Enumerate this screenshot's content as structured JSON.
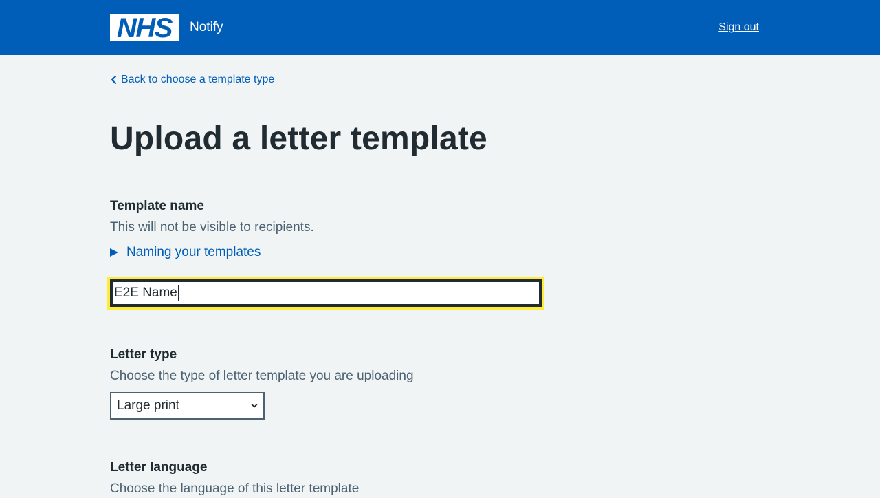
{
  "header": {
    "logo_text": "NHS",
    "service_name": "Notify",
    "sign_out_label": "Sign out",
    "background_color": "#005eb8"
  },
  "back_link": {
    "label": "Back to choose a template type",
    "icon": "chevron-left-icon"
  },
  "page_title": "Upload a letter template",
  "template_name": {
    "label": "Template name",
    "hint": "This will not be visible to recipients.",
    "details_summary": "Naming your templates",
    "value": "E2E Name",
    "focused": true
  },
  "letter_type": {
    "label": "Letter type",
    "hint": "Choose the type of letter template you are uploading",
    "selected": "Large print"
  },
  "letter_language": {
    "label": "Letter language",
    "hint": "Choose the language of this letter template"
  },
  "colors": {
    "link": "#005eb8",
    "text": "#212b32",
    "hint": "#4c6272",
    "focus": "#ffeb3b",
    "page_background": "#f0f4f5"
  }
}
